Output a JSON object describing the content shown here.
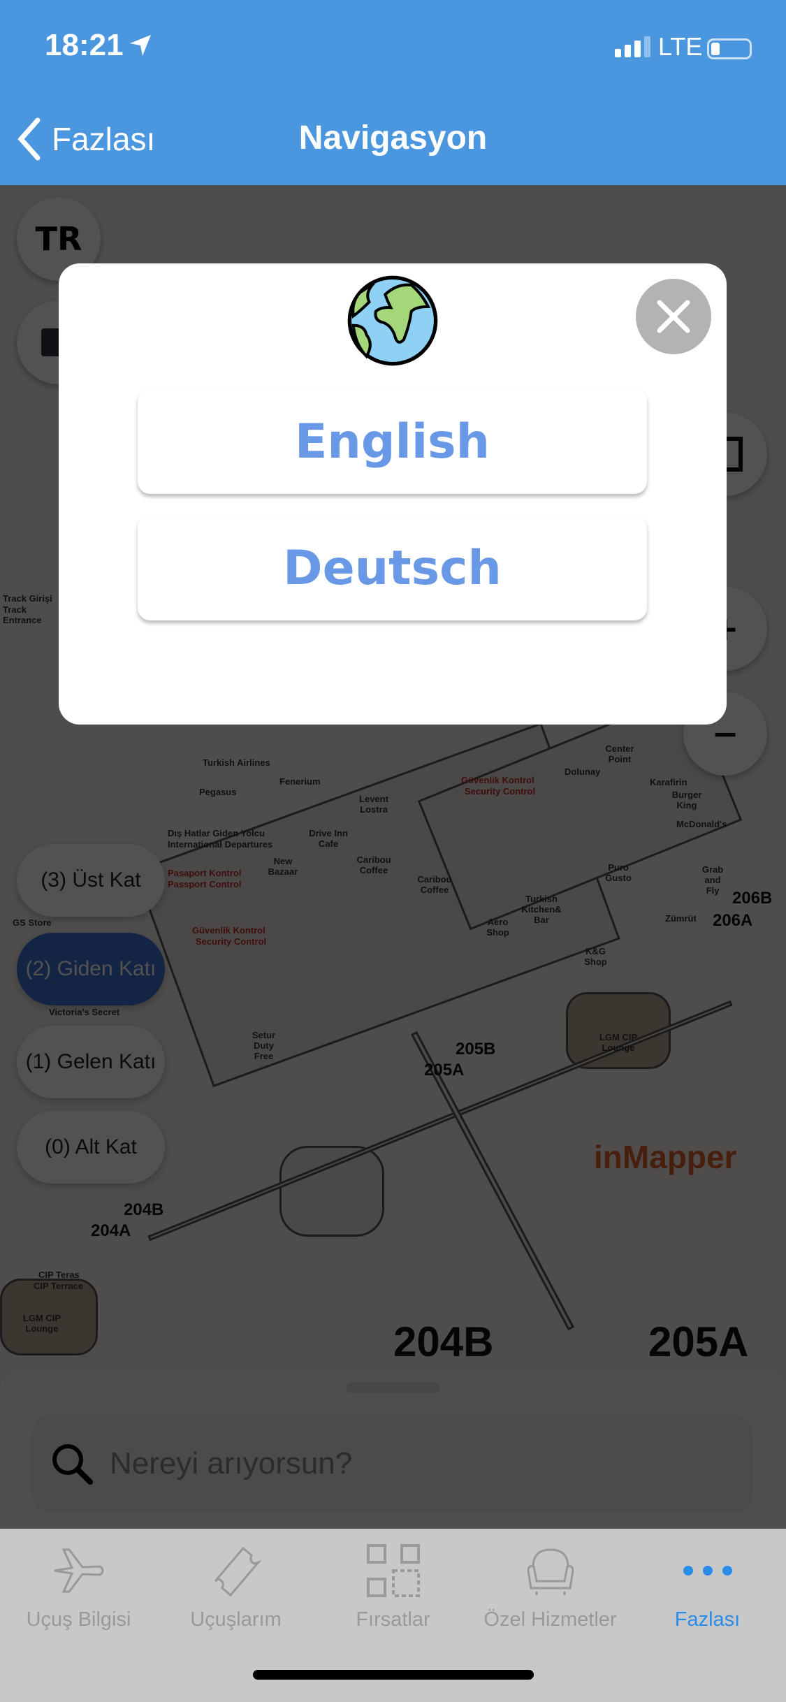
{
  "status_bar": {
    "time": "18:21",
    "network": "LTE",
    "battery_percent": 15
  },
  "nav": {
    "back_label": "Fazlası",
    "title": "Navigasyon"
  },
  "map": {
    "language_badge": "TR",
    "labels": [
      "Track Girişi",
      "Track Entrance",
      "Turkish Airlines",
      "Pegasus",
      "Fenerium",
      "Levent Lostra",
      "Dış Hatlar Giden Yolcu",
      "International Departures",
      "Drive Inn Cafe",
      "New Bazaar",
      "Caribou Coffee",
      "Caribou Coffee",
      "Pasaport Kontrol",
      "Passport Control",
      "Güvenlik Kontrol",
      "Security Control",
      "Güvenlik Kontrol",
      "Security Control",
      "Dolunay",
      "Center Point",
      "Karafirin",
      "Burger King",
      "McDonald's",
      "Puro Gusto",
      "Turkish Kitchen& Bar",
      "Aero Shop",
      "K&G Shop",
      "Zümrüt",
      "Grab and Fly",
      "206A",
      "206B",
      "GS Store",
      "Victoria's Secret",
      "Setur Duty Free",
      "205B",
      "205A",
      "LGM CIP Lounge",
      "204B",
      "204A",
      "CIP Teras",
      "CIP Terrace",
      "LGM CIP Lounge",
      "204B",
      "205A"
    ],
    "watermark": "inMapper",
    "floors": [
      {
        "label": "(3) Üst Kat",
        "active": false
      },
      {
        "label": "(2) Giden Katı",
        "active": true
      },
      {
        "label": "(1) Gelen Katı",
        "active": false
      },
      {
        "label": "(0) Alt Kat",
        "active": false
      }
    ]
  },
  "search": {
    "placeholder": "Nereyi arıyorsun?"
  },
  "modal": {
    "icon": "globe-icon",
    "options": [
      "English",
      "Deutsch"
    ],
    "close_icon": "close-icon"
  },
  "tabs": [
    {
      "label": "Uçuş Bilgisi",
      "icon": "airplane-icon"
    },
    {
      "label": "Uçuşlarım",
      "icon": "ticket-icon"
    },
    {
      "label": "Fırsatlar",
      "icon": "qr-code-icon"
    },
    {
      "label": "Özel Hizmetler",
      "icon": "armchair-icon"
    },
    {
      "label": "Fazlası",
      "icon": "more-dots-icon",
      "active": true
    }
  ],
  "colors": {
    "header": "#4a97e0",
    "accent": "#2a8be8",
    "language_button_text": "#6898e6",
    "active_floor": "#3d6fd6"
  }
}
